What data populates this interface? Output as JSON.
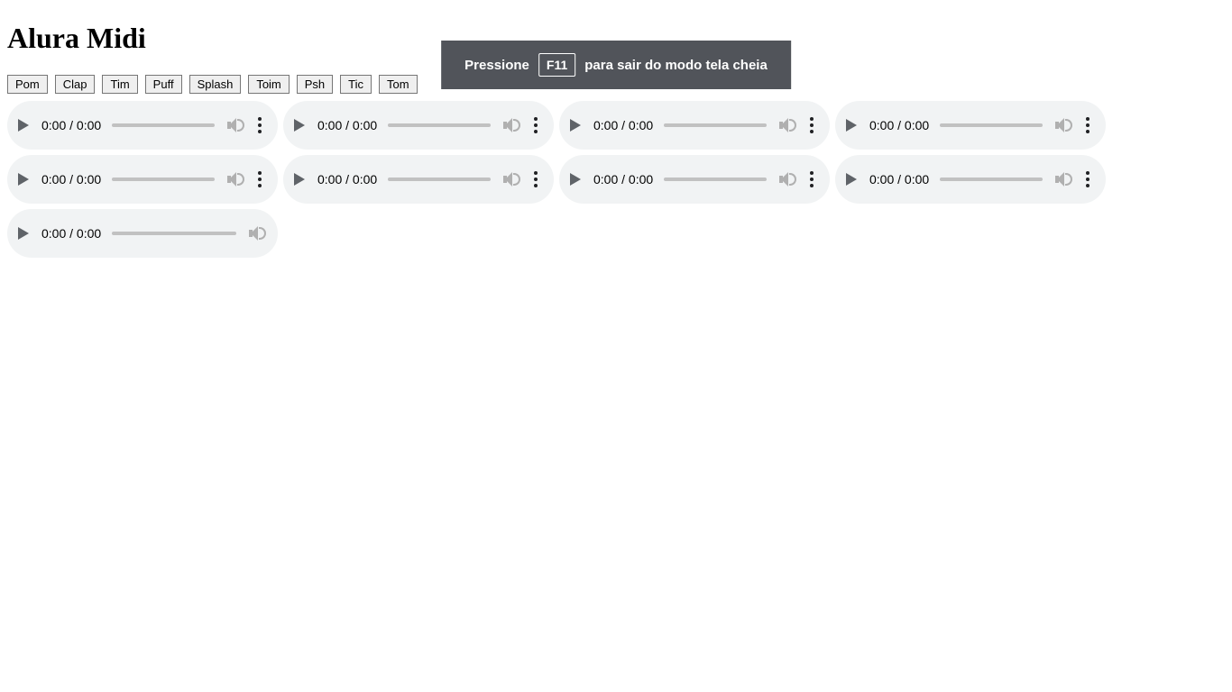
{
  "page_title": "Alura Midi",
  "buttons": [
    "Pom",
    "Clap",
    "Tim",
    "Puff",
    "Splash",
    "Toim",
    "Psh",
    "Tic",
    "Tom"
  ],
  "audio_time": "0:00 / 0:00",
  "audio_count": 9,
  "fullscreen_toast": {
    "before": "Pressione",
    "key": "F11",
    "after": "para sair do modo tela cheia"
  }
}
